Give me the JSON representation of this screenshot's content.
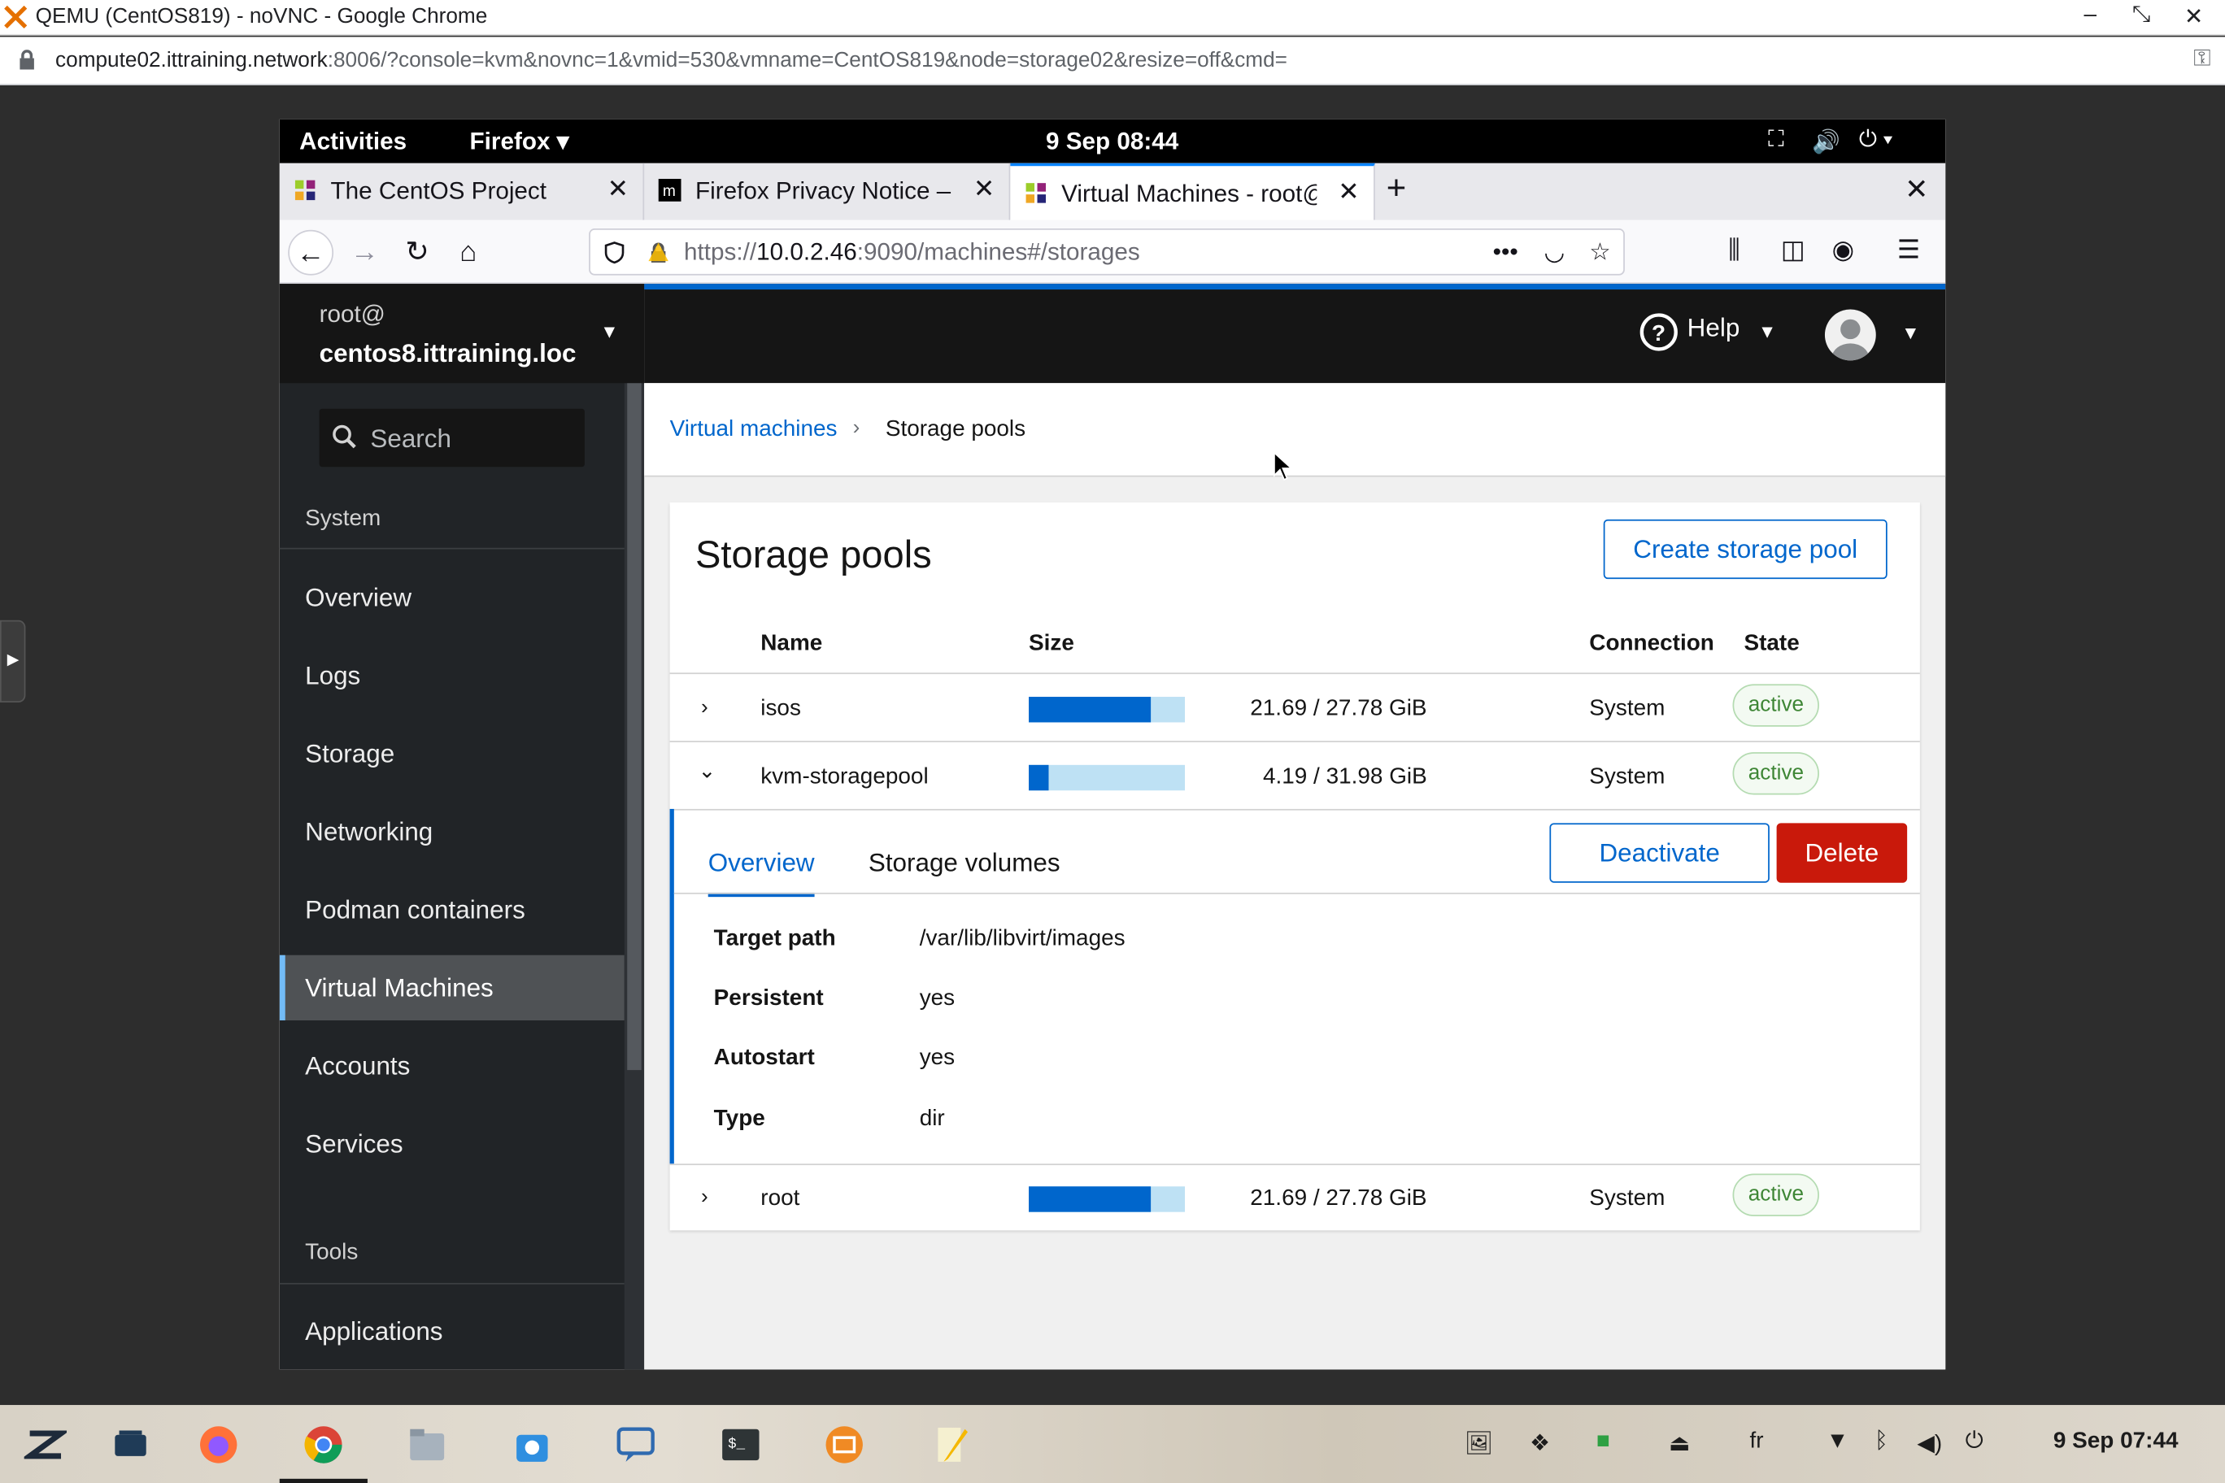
{
  "chrome": {
    "title": "QEMU (CentOS819) - noVNC - Google Chrome",
    "url_host": "compute02.ittraining.network",
    "url_rest": ":8006/?console=kvm&novnc=1&vmid=530&vmname=CentOS819&node=storage02&resize=off&cmd=",
    "minimize": "–",
    "restore": "⤡",
    "close": "✕",
    "key_icon": "⚿"
  },
  "gnome": {
    "activities": "Activities",
    "app_menu": "Firefox ▾",
    "clock": "9 Sep  08:44",
    "tray_network": "⛶",
    "tray_volume": "🔊",
    "tray_power": "⏻ ▾"
  },
  "firefox": {
    "tabs": [
      {
        "label": "The CentOS Project"
      },
      {
        "label": "Firefox Privacy Notice — "
      },
      {
        "label": "Virtual Machines - root@"
      }
    ],
    "tab_close": "✕",
    "new_tab": "+",
    "close_window": "✕",
    "url_prefix": "https://",
    "url_host": "10.0.2.46",
    "url_rest": ":9090/machines#/storages",
    "more": "•••",
    "back": "←",
    "forward": "→",
    "reload": "↻",
    "home": "⌂",
    "pocket": "◡",
    "star": "☆",
    "library": "⫼",
    "sidebar": "◫",
    "account": "◉",
    "menu": "☰"
  },
  "cockpit": {
    "user": "root@",
    "host": "centos8.ittraining.loc",
    "search_placeholder": "Search",
    "section_system": "System",
    "nav": [
      {
        "label": "Overview"
      },
      {
        "label": "Logs"
      },
      {
        "label": "Storage"
      },
      {
        "label": "Networking"
      },
      {
        "label": "Podman containers"
      },
      {
        "label": "Virtual Machines"
      },
      {
        "label": "Accounts"
      },
      {
        "label": "Services"
      }
    ],
    "section_tools": "Tools",
    "nav_tools": [
      {
        "label": "Applications"
      }
    ],
    "help": "Help",
    "breadcrumb": {
      "parent": "Virtual machines",
      "sep": "›",
      "current": "Storage pools"
    },
    "page_title": "Storage pools",
    "create_button": "Create storage pool",
    "columns": {
      "name": "Name",
      "size": "Size",
      "connection": "Connection",
      "state": "State"
    },
    "pools": [
      {
        "name": "isos",
        "size": "21.69 / 27.78 GiB",
        "usage": 0.781,
        "connection": "System",
        "state": "active",
        "chevron": "›"
      },
      {
        "name": "kvm-storagepool",
        "size": "4.19 / 31.98 GiB",
        "usage": 0.131,
        "connection": "System",
        "state": "active",
        "chevron": "⌄"
      },
      {
        "name": "root",
        "size": "21.69 / 27.78 GiB",
        "usage": 0.781,
        "connection": "System",
        "state": "active",
        "chevron": "›"
      }
    ],
    "expanded": {
      "tab_overview": "Overview",
      "tab_volumes": "Storage volumes",
      "deactivate": "Deactivate",
      "delete": "Delete",
      "details": [
        {
          "k": "Target path",
          "v": "/var/lib/libvirt/images"
        },
        {
          "k": "Persistent",
          "v": "yes"
        },
        {
          "k": "Autostart",
          "v": "yes"
        },
        {
          "k": "Type",
          "v": "dir"
        }
      ]
    }
  },
  "taskbar": {
    "lang": "fr",
    "clock": "9 Sep  07:44"
  },
  "colors": {
    "accent": "#0066cc",
    "danger": "#c9190b",
    "success": "#3e8635",
    "bar_bg": "#bee1f4"
  }
}
